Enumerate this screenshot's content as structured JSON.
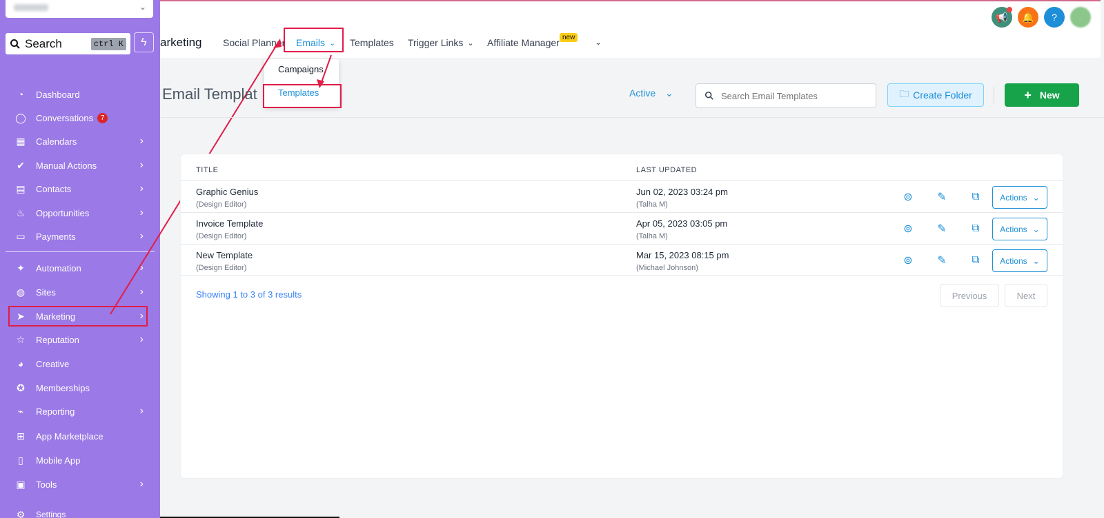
{
  "sidebar": {
    "search_label": "Search",
    "search_shortcut": "ctrl K",
    "items": [
      {
        "label": "Dashboard",
        "icon": "dashboard-icon"
      },
      {
        "label": "Conversations",
        "icon": "chat-icon",
        "badge": "7"
      },
      {
        "label": "Calendars",
        "icon": "calendar-icon"
      },
      {
        "label": "Manual Actions",
        "icon": "check-circle-icon"
      },
      {
        "label": "Contacts",
        "icon": "contacts-icon"
      },
      {
        "label": "Opportunities",
        "icon": "flame-icon"
      },
      {
        "label": "Payments",
        "icon": "card-icon"
      },
      {
        "label": "Automation",
        "icon": "wand-icon"
      },
      {
        "label": "Sites",
        "icon": "globe-icon"
      },
      {
        "label": "Marketing",
        "icon": "paper-plane-icon"
      },
      {
        "label": "Reputation",
        "icon": "star-icon"
      },
      {
        "label": "Creative",
        "icon": "palette-icon"
      },
      {
        "label": "Memberships",
        "icon": "award-icon"
      },
      {
        "label": "Reporting",
        "icon": "chart-icon"
      },
      {
        "label": "App Marketplace",
        "icon": "grid-icon"
      },
      {
        "label": "Mobile App",
        "icon": "phone-icon"
      },
      {
        "label": "Tools",
        "icon": "toolbox-icon"
      },
      {
        "label": "Settings",
        "icon": "gear-icon"
      }
    ]
  },
  "topbar": {
    "title": "arketing",
    "tabs": [
      "Social Planner",
      "Emails",
      "Templates",
      "Trigger Links",
      "Affiliate Manager"
    ],
    "new_badge": "new"
  },
  "dropdown": {
    "options": [
      "Campaigns",
      "Templates"
    ]
  },
  "content": {
    "title": "Email Templat",
    "filter": "Active",
    "search_placeholder": "Search Email Templates",
    "create_folder": "Create Folder",
    "new_button": "New",
    "columns": [
      "TITLE",
      "LAST UPDATED"
    ],
    "rows": [
      {
        "name": "Graphic Genius",
        "sub": "(Design Editor)",
        "date": "Jun 02, 2023 03:24 pm",
        "by": "(Talha M)",
        "actions": "Actions"
      },
      {
        "name": "Invoice Template",
        "sub": "(Design Editor)",
        "date": "Apr 05, 2023 03:05 pm",
        "by": "(Talha M)",
        "actions": "Actions"
      },
      {
        "name": "New Template",
        "sub": "(Design Editor)",
        "date": "Mar 15, 2023 08:15 pm",
        "by": "(Michael Johnson)",
        "actions": "Actions"
      }
    ],
    "showing": "Showing 1 to 3 of 3 results",
    "prev": "Previous",
    "next": "Next"
  },
  "colors": {
    "sidebar": "#9b79e6",
    "accent": "#1d8fd8",
    "new_button": "#16a34a",
    "highlight": "#e11d48"
  }
}
